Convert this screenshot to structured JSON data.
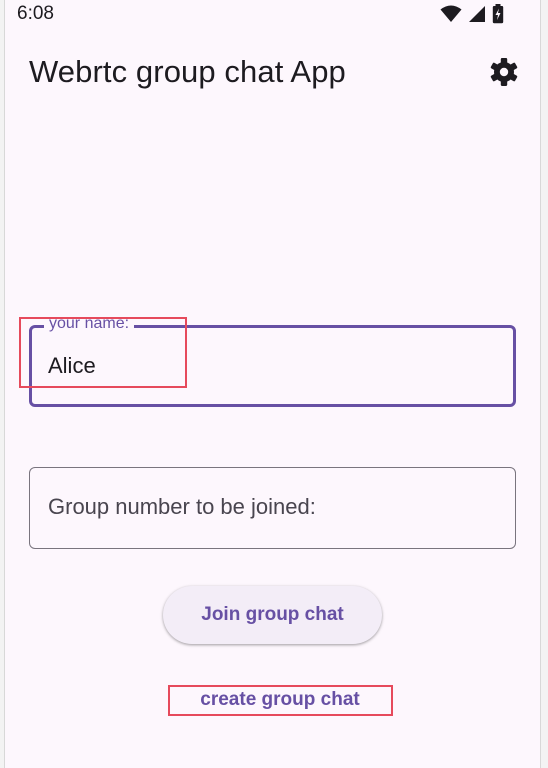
{
  "status_bar": {
    "time": "6:08",
    "icons": [
      "wifi-icon",
      "cellular-signal-icon",
      "battery-charging-icon"
    ]
  },
  "app_bar": {
    "title": "Webrtc group chat App",
    "action_icon": "gear-icon"
  },
  "form": {
    "name_field": {
      "label": "your name:",
      "value": "Alice"
    },
    "group_field": {
      "placeholder": "Group number to be joined:",
      "value": ""
    }
  },
  "actions": {
    "join_label": "Join group chat",
    "create_label": "create group chat"
  },
  "colors": {
    "primary": "#6750a4",
    "background": "#fdf7fd",
    "text": "#1d1b20",
    "outline": "#79747e",
    "highlight": "#e64a5c"
  }
}
